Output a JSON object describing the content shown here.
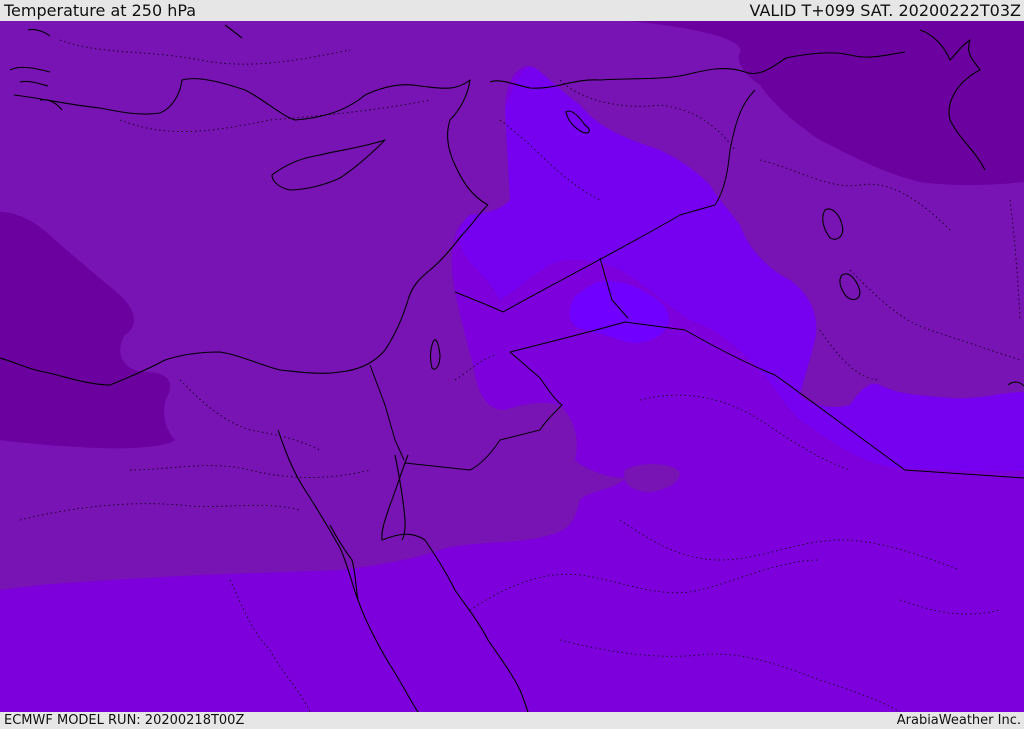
{
  "header": {
    "title": "Temperature at 250 hPa",
    "valid_time": "VALID T+099 SAT. 20200222T03Z"
  },
  "footer": {
    "model_run": "ECMWF MODEL RUN: 20200218T00Z",
    "credit": "ArabiaWeather Inc."
  },
  "colors": {
    "base": "#7d00dc",
    "band_mid": "#7813b4",
    "band_dark": "#6b019e",
    "band_warm": "#7600f0",
    "core": "#7000ff",
    "line": "#000000"
  }
}
